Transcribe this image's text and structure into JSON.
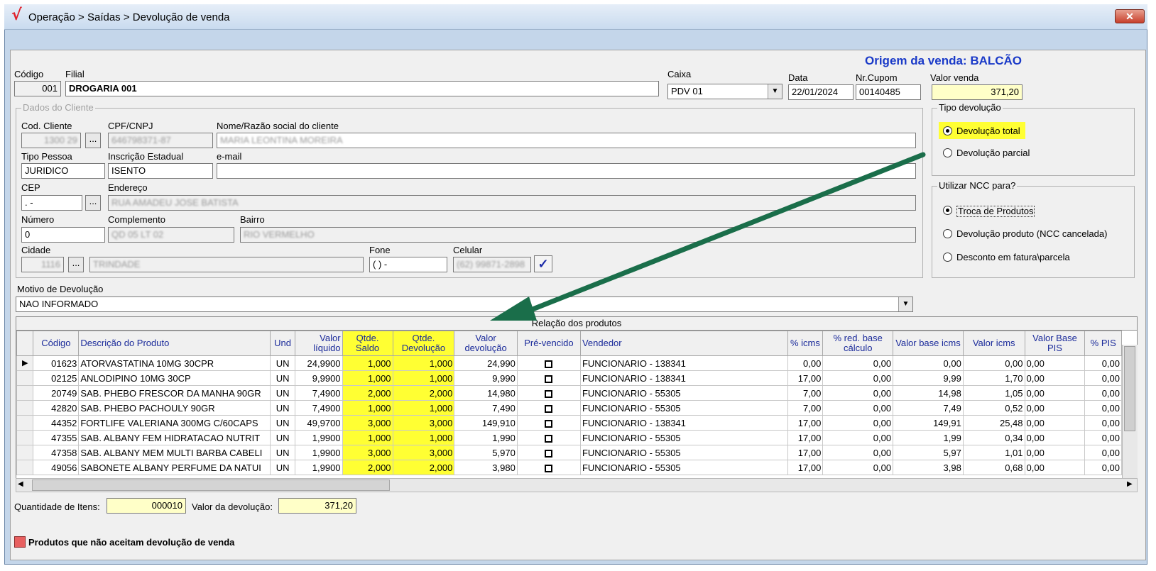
{
  "window": {
    "title": "Operação > Saídas > Devolução de venda",
    "close": "✕"
  },
  "origem": "Origem da venda: BALCÃO",
  "header": {
    "codigo_label": "Código",
    "codigo": "001",
    "filial_label": "Filial",
    "filial": "DROGARIA 001",
    "caixa_label": "Caixa",
    "caixa": "PDV 01",
    "data_label": "Data",
    "data": "22/01/2024",
    "cupom_label": "Nr.Cupom",
    "cupom": "00140485",
    "valor_venda_label": "Valor venda",
    "valor_venda": "371,20"
  },
  "cliente": {
    "group_title": "Dados do Cliente",
    "cod_label": "Cod. Cliente",
    "cod": "1300 29",
    "cpf_label": "CPF/CNPJ",
    "cpf": "646798371-87",
    "nome_label": "Nome/Razão social do cliente",
    "nome": "MARIA LEONTINA MOREIRA",
    "tipo_label": "Tipo Pessoa",
    "tipo": "JURIDICO",
    "ie_label": "Inscrição Estadual",
    "ie": "ISENTO",
    "email_label": "e-mail",
    "email": "",
    "cep_label": "CEP",
    "cep": " .  -",
    "endereco_label": "Endereço",
    "endereco": "RUA AMADEU JOSE BATISTA",
    "numero_label": "Número",
    "numero": "0",
    "complemento_label": "Complemento",
    "complemento": "QD 05 LT 02",
    "bairro_label": "Bairro",
    "bairro": "RIO VERMELHO",
    "cidade_label": "Cidade",
    "cidade_cod": "1116",
    "cidade": "TRINDADE",
    "fone_label": "Fone",
    "fone": "(  )      -",
    "celular_label": "Celular",
    "celular": "(62) 99871-2898",
    "ellipsis": "..."
  },
  "tipo_devolucao": {
    "title": "Tipo devolução",
    "options": [
      "Devolução total",
      "Devolução parcial"
    ],
    "selected": 0
  },
  "ncc": {
    "title": "Utilizar NCC para?",
    "options": [
      "Troca de Produtos",
      "Devolução produto (NCC cancelada)",
      "Desconto em fatura\\parcela"
    ],
    "selected": 0
  },
  "motivo": {
    "label": "Motivo de Devolução",
    "value": "NAO INFORMADO"
  },
  "grid": {
    "caption": "Relação dos produtos",
    "columns": [
      "Código",
      "Descrição do Produto",
      "Und",
      "Valor líquido",
      "Qtde. Saldo",
      "Qtde. Devolução",
      "Valor devolução",
      "Pré-vencido",
      "Vendedor",
      "% icms",
      "% red. base cálculo",
      "Valor base icms",
      "Valor icms",
      "Valor Base PIS",
      "% PIS"
    ],
    "rows": [
      [
        "01623",
        "ATORVASTATINA 10MG 30CPR",
        "UN",
        "24,9900",
        "1,000",
        "1,000",
        "24,990",
        "",
        "FUNCIONARIO - 138341",
        "0,00",
        "0,00",
        "0,00",
        "0,00",
        "0,00",
        "0,00"
      ],
      [
        "02125",
        "ANLODIPINO 10MG  30CP",
        "UN",
        "9,9900",
        "1,000",
        "1,000",
        "9,990",
        "",
        "FUNCIONARIO - 138341",
        "17,00",
        "0,00",
        "9,99",
        "1,70",
        "0,00",
        "0,00"
      ],
      [
        "20749",
        "SAB. PHEBO FRESCOR DA MANHA 90GR",
        "UN",
        "7,4900",
        "2,000",
        "2,000",
        "14,980",
        "",
        "FUNCIONARIO - 55305",
        "7,00",
        "0,00",
        "14,98",
        "1,05",
        "0,00",
        "0,00"
      ],
      [
        "42820",
        "SAB. PHEBO PACHOULY 90GR",
        "UN",
        "7,4900",
        "1,000",
        "1,000",
        "7,490",
        "",
        "FUNCIONARIO - 55305",
        "7,00",
        "0,00",
        "7,49",
        "0,52",
        "0,00",
        "0,00"
      ],
      [
        "44352",
        "FORTLIFE VALERIANA  300MG C/60CAPS",
        "UN",
        "49,9700",
        "3,000",
        "3,000",
        "149,910",
        "",
        "FUNCIONARIO - 138341",
        "17,00",
        "0,00",
        "149,91",
        "25,48",
        "0,00",
        "0,00"
      ],
      [
        "47355",
        "SAB. ALBANY FEM HIDRATACAO NUTRIT",
        "UN",
        "1,9900",
        "1,000",
        "1,000",
        "1,990",
        "",
        "FUNCIONARIO - 55305",
        "17,00",
        "0,00",
        "1,99",
        "0,34",
        "0,00",
        "0,00"
      ],
      [
        "47358",
        "SAB. ALBANY MEM MULTI BARBA CABELI",
        "UN",
        "1,9900",
        "3,000",
        "3,000",
        "5,970",
        "",
        "FUNCIONARIO - 55305",
        "17,00",
        "0,00",
        "5,97",
        "1,01",
        "0,00",
        "0,00"
      ],
      [
        "49056",
        "SABONETE ALBANY PERFUME DA NATUI",
        "UN",
        "1,9900",
        "2,000",
        "2,000",
        "3,980",
        "",
        "FUNCIONARIO - 55305",
        "17,00",
        "0,00",
        "3,98",
        "0,68",
        "0,00",
        "0,00"
      ]
    ]
  },
  "footer": {
    "qtd_label": "Quantidade de Itens:",
    "qtd": "000010",
    "valor_label": "Valor da devolução:",
    "valor": "371,20",
    "legend": "Produtos que não aceitam devolução de venda"
  },
  "colors": {
    "highlight": "#ffff33",
    "arrow": "#1a6e4a",
    "legend_box": "#e86060",
    "origin_text": "#1a3ac8"
  }
}
